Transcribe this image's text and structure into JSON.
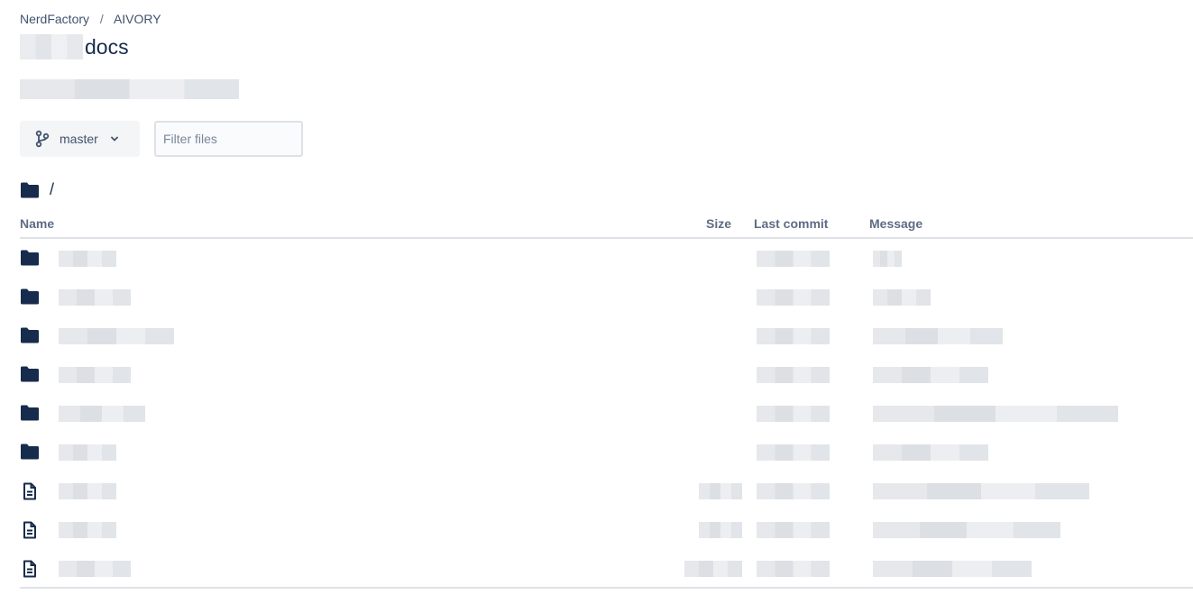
{
  "breadcrumb": {
    "owner": "NerdFactory",
    "separator": "/",
    "project": "AIVORY"
  },
  "repo": {
    "title_suffix": "docs"
  },
  "toolbar": {
    "branch": "master",
    "filter_placeholder": "Filter files"
  },
  "path": {
    "current": "/"
  },
  "table": {
    "headers": {
      "name": "Name",
      "size": "Size",
      "last_commit": "Last commit",
      "message": "Message"
    },
    "rows": [
      {
        "type": "folder",
        "icon": "folder-icon"
      },
      {
        "type": "folder",
        "icon": "folder-icon"
      },
      {
        "type": "folder",
        "icon": "folder-icon"
      },
      {
        "type": "folder",
        "icon": "folder-icon"
      },
      {
        "type": "folder",
        "icon": "folder-icon"
      },
      {
        "type": "folder",
        "icon": "folder-icon"
      },
      {
        "type": "file",
        "icon": "file-icon"
      },
      {
        "type": "file",
        "icon": "file-icon"
      },
      {
        "type": "file",
        "icon": "file-icon"
      }
    ]
  },
  "colors": {
    "text": "#172b4d",
    "muted": "#5e6c84",
    "icon": "#172b4d",
    "border": "#dfe1e6",
    "button_bg": "#f4f5f7"
  }
}
